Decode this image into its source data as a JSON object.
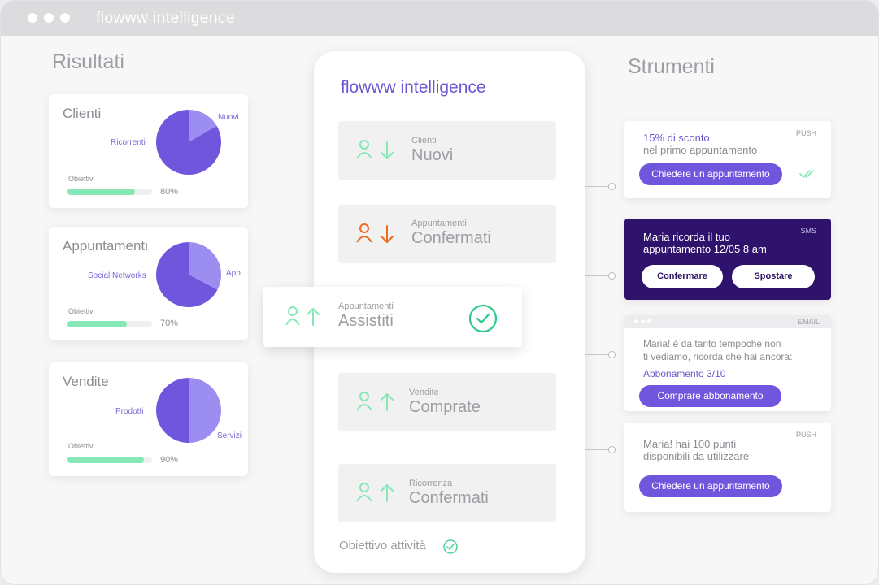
{
  "window": {
    "app_title": "flowww intelligence"
  },
  "results": {
    "title": "Risultati",
    "cards": [
      {
        "title": "Clienti",
        "label_a": "Ricorrenti",
        "label_b": "Nuovi",
        "objective_label": "Obiettivi",
        "progress": 0.8,
        "percent_text": "80%"
      },
      {
        "title": "Appuntamenti",
        "label_a": "Social Networks",
        "label_b": "App",
        "objective_label": "Obiettivi",
        "progress": 0.7,
        "percent_text": "70%"
      },
      {
        "title": "Vendite",
        "label_a": "Prodotti",
        "label_b": "Servizi",
        "objective_label": "Obiettivi",
        "progress": 0.9,
        "percent_text": "90%"
      }
    ]
  },
  "phone": {
    "title": "flowww intelligence",
    "rows": [
      {
        "small": "Clienti",
        "big": "Nuovi",
        "arrow": "down",
        "color": "#86e8b6"
      },
      {
        "small": "Appuntamenti",
        "big": "Confermati",
        "arrow": "down",
        "color": "#f06a1e"
      },
      {
        "small": "Vendite",
        "big": "Comprate",
        "arrow": "up",
        "color": "#86e8b6"
      },
      {
        "small": "Ricorrenza",
        "big": "Confermati",
        "arrow": "up",
        "color": "#86e8b6"
      }
    ],
    "floating": {
      "small": "Appuntamenti",
      "big": "Assistiti"
    },
    "footer": "Obiettivo attività"
  },
  "tools": {
    "title": "Strumenti",
    "push1": {
      "tag": "PUSH",
      "highlight": "15% di sconto",
      "line2": "nel primo appuntamento",
      "button": "Chiedere un appuntamento"
    },
    "sms": {
      "tag": "SMS",
      "line1": "Maria ricorda il tuo",
      "line2": "appuntamento 12/05 8 am",
      "confirm": "Confermare",
      "move": "Spostare"
    },
    "email": {
      "tag": "EMAIL",
      "line1": "Maria! è da tanto tempoche non",
      "line2": "ti vediamo, ricorda che hai ancora:",
      "highlight": "Abbonamento 3/10",
      "button": "Comprare abbonamento"
    },
    "push2": {
      "tag": "PUSH",
      "line1": "Maria! hai 100 punti",
      "line2": "disponibili da utilizzare",
      "button": "Chiedere un appuntamento"
    }
  },
  "colors": {
    "accent": "#7056dc",
    "pie_main": "#7056dc",
    "pie_light": "#9c8ef0",
    "progress": "#86e8b6",
    "sms_bg": "#2e126b",
    "warning": "#f06a1e"
  }
}
